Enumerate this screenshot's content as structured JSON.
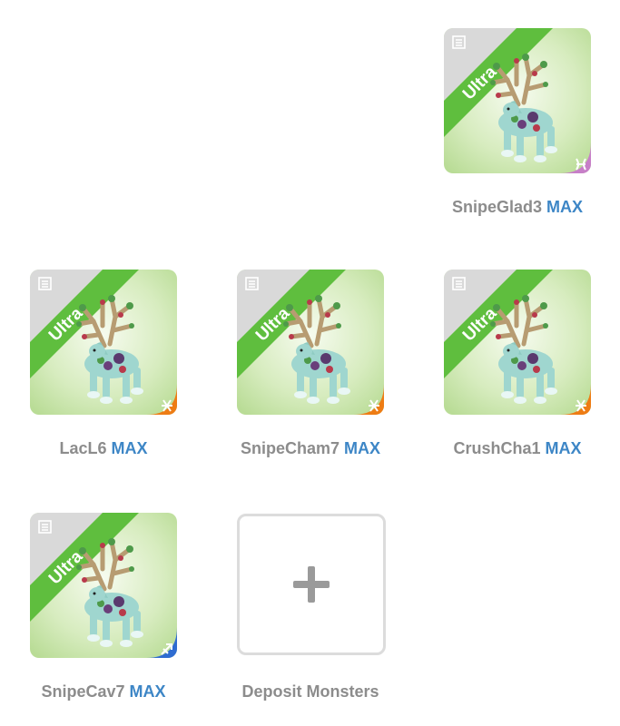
{
  "colors": {
    "rarity_band": "#5fbe3e",
    "max_label": "#3d86c6",
    "caption": "#8c8c8c",
    "pisces": "#c77fc8",
    "orange": "#ee7c14",
    "blue": "#2f6cd1"
  },
  "slots": [
    {
      "name": "SnipeGlad3",
      "level": "MAX",
      "rarity": "Ultra",
      "element": "pisces-icon"
    },
    {
      "name": "LacL6",
      "level": "MAX",
      "rarity": "Ultra",
      "element": "orange-element-icon"
    },
    {
      "name": "SnipeCham7",
      "level": "MAX",
      "rarity": "Ultra",
      "element": "orange-element-icon"
    },
    {
      "name": "CrushCha1",
      "level": "MAX",
      "rarity": "Ultra",
      "element": "orange-element-icon"
    },
    {
      "name": "SnipeCav7",
      "level": "MAX",
      "rarity": "Ultra",
      "element": "blue-arrow-icon"
    }
  ],
  "deposit": {
    "label": "Deposit Monsters"
  }
}
